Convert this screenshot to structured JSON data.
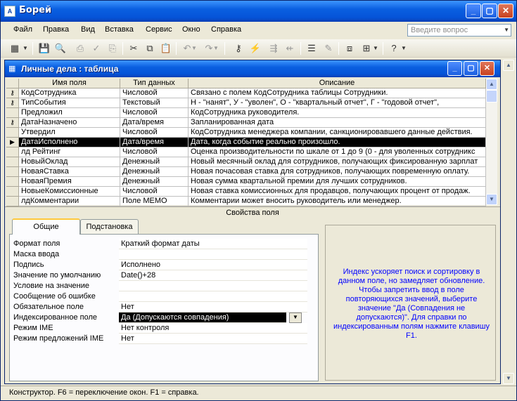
{
  "app": {
    "title": "Борей",
    "icon": "app-icon"
  },
  "menu": [
    "Файл",
    "Правка",
    "Вид",
    "Вставка",
    "Сервис",
    "Окно",
    "Справка"
  ],
  "help_box": {
    "placeholder": "Введите вопрос"
  },
  "toolbar": {
    "icons": [
      "view-icon",
      "save-icon",
      "preview-icon",
      "print-icon",
      "spellcheck-icon",
      "cut-icon",
      "copy-icon",
      "paste-icon",
      "undo-icon",
      "redo-icon",
      "key-icon",
      "indexes-icon",
      "insert-rows-icon",
      "delete-rows-icon",
      "properties-icon",
      "build-icon",
      "database-window-icon",
      "new-object-icon",
      "help-icon"
    ]
  },
  "child": {
    "title": "Личные дела : таблица"
  },
  "grid": {
    "headers": [
      "Имя поля",
      "Тип данных",
      "Описание"
    ],
    "rows": [
      {
        "key": true,
        "name": "КодСотрудника",
        "type": "Числовой",
        "desc": "Связано с полем КодСотрудника таблицы Сотрудники."
      },
      {
        "key": true,
        "name": "ТипСобытия",
        "type": "Текстовый",
        "desc": "Н - \"нанят\", У - \"уволен\", О - \"квартальный отчет\", Г - \"годовой отчет\","
      },
      {
        "key": false,
        "name": "Предложил",
        "type": "Числовой",
        "desc": "КодСотрудника руководителя."
      },
      {
        "key": true,
        "name": "ДатаНазначено",
        "type": "Дата/время",
        "desc": "Запланированная дата"
      },
      {
        "key": false,
        "name": "Утвердил",
        "type": "Числовой",
        "desc": "КодСотрудника менеджера компании, санкционировавшего данные действия."
      },
      {
        "key": false,
        "active": true,
        "name": "ДатаИсполнено",
        "type": "Дата/время",
        "desc": "Дата, когда событие реально произошло."
      },
      {
        "key": false,
        "name": "лд Рейтинг",
        "type": "Числовой",
        "desc": "Оценка производительности по шкале от 1 до 9 (0 - для уволенных сотрудникс"
      },
      {
        "key": false,
        "name": "НовыйОклад",
        "type": "Денежный",
        "desc": "Новый месячный оклад для сотрудников, получающих фиксированную зарплат"
      },
      {
        "key": false,
        "name": "НоваяСтавка",
        "type": "Денежный",
        "desc": "Новая почасовая ставка для сотрудников, получающих повременную оплату."
      },
      {
        "key": false,
        "name": "НоваяПремия",
        "type": "Денежный",
        "desc": "Новая сумма квартальной премии для лучших сотрудников."
      },
      {
        "key": false,
        "name": "НовыеКомиссионные",
        "type": "Числовой",
        "desc": "Новая ставка комиссионных для продавцов, получающих процент от продаж."
      },
      {
        "key": false,
        "name": "лдКомментарии",
        "type": "Поле MEMO",
        "desc": "Комментарии может вносить руководитель или менеджер."
      }
    ]
  },
  "props": {
    "label": "Свойства поля",
    "tabs": [
      "Общие",
      "Подстановка"
    ],
    "rows": [
      {
        "label": "Формат поля",
        "value": "Краткий формат даты"
      },
      {
        "label": "Маска ввода",
        "value": ""
      },
      {
        "label": "Подпись",
        "value": "Исполнено"
      },
      {
        "label": "Значение по умолчанию",
        "value": "Date()+28"
      },
      {
        "label": "Условие на значение",
        "value": ""
      },
      {
        "label": "Сообщение об ошибке",
        "value": ""
      },
      {
        "label": "Обязательное поле",
        "value": "Нет"
      },
      {
        "label": "Индексированное поле",
        "value": "Да (Допускаются совпадения)",
        "active": true
      },
      {
        "label": "Режим IME",
        "value": "Нет контроля"
      },
      {
        "label": "Режим предложений IME",
        "value": "Нет"
      }
    ]
  },
  "help_text": "Индекс ускоряет поиск и сортировку в данном поле, но замедляет обновление. Чтобы запретить ввод в поле повторяющихся значений, выберите значение \"Да (Совпадения не допускаются)\". Для справки по индексированным полям нажмите клавишу F1.",
  "status": "Конструктор. F6 = переключение окон. F1 = справка."
}
